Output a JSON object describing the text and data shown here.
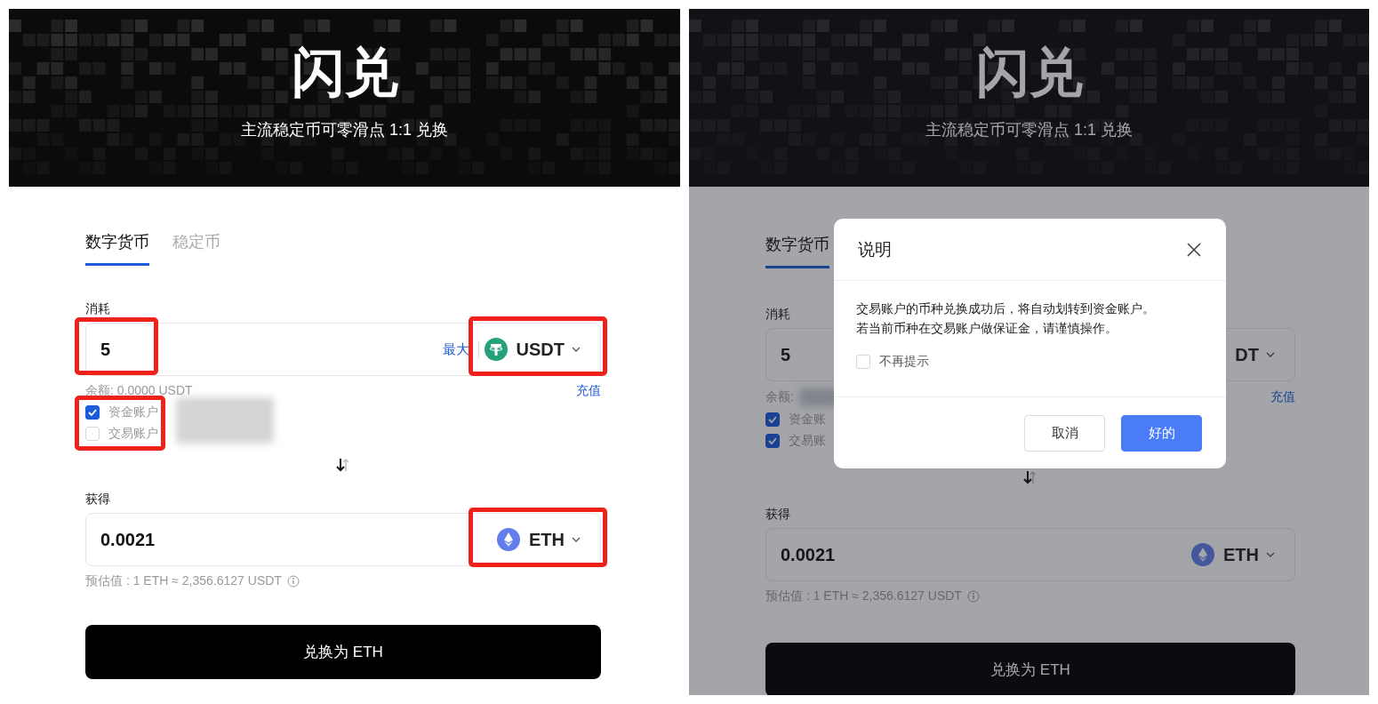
{
  "panels": [
    {
      "header": {
        "title": "闪兑",
        "subtitle": "主流稳定币可零滑点 1:1 兑换"
      },
      "tabs": [
        {
          "label": "数字货币",
          "selected": true
        },
        {
          "label": "稳定币",
          "selected": false
        }
      ],
      "pay": {
        "label": "消耗",
        "amount": {
          "value": "5",
          "highlighted": true
        },
        "max_link": "最大",
        "token": {
          "symbol": "USDT",
          "kind": "usdt",
          "highlighted": true
        },
        "balance": {
          "text": "余额: 0.0000 USDT"
        },
        "deposit_link": "充值",
        "accounts_highlighted": true,
        "accounts_redacted": true,
        "accounts": [
          {
            "label": "资金账户",
            "checked": true
          },
          {
            "label": "交易账户",
            "checked": false
          }
        ]
      },
      "receive": {
        "label": "获得",
        "amount": {
          "value": "0.0021"
        },
        "token": {
          "symbol": "ETH",
          "kind": "eth",
          "highlighted": true
        },
        "estimate": "预估值 : 1 ETH ≈ 2,356.6127 USDT"
      },
      "submit": "兑换为 ETH"
    },
    {
      "header": {
        "title": "闪兑",
        "subtitle": "主流稳定币可零滑点 1:1 兑换"
      },
      "tabs": [
        {
          "label": "数字货币",
          "selected": true
        }
      ],
      "pay": {
        "label": "消耗",
        "amount": {
          "value": "5"
        },
        "token": {
          "symbol": "DT"
        },
        "balance": {
          "text": "余额:",
          "redacted": true
        },
        "deposit_link": "充值",
        "accounts": [
          {
            "label": "资金账",
            "checked": true
          },
          {
            "label": "交易账",
            "checked": true
          }
        ]
      },
      "receive": {
        "label": "获得",
        "amount": {
          "value": "0.0021"
        },
        "token": {
          "symbol": "ETH",
          "kind": "eth"
        },
        "estimate": "预估值 : 1 ETH ≈ 2,356.6127 USDT"
      },
      "submit": "兑换为 ETH",
      "dialog": {
        "title": "说明",
        "body": [
          "交易账户的币种兑换成功后，将自动划转到资金账户。",
          "若当前币种在交易账户做保证金，请谨慎操作。"
        ],
        "dont_show": {
          "label": "不再提示",
          "checked": false
        },
        "buttons": [
          {
            "label": "取消",
            "kind": "secondary"
          },
          {
            "label": "好的",
            "kind": "primary"
          }
        ]
      }
    }
  ]
}
